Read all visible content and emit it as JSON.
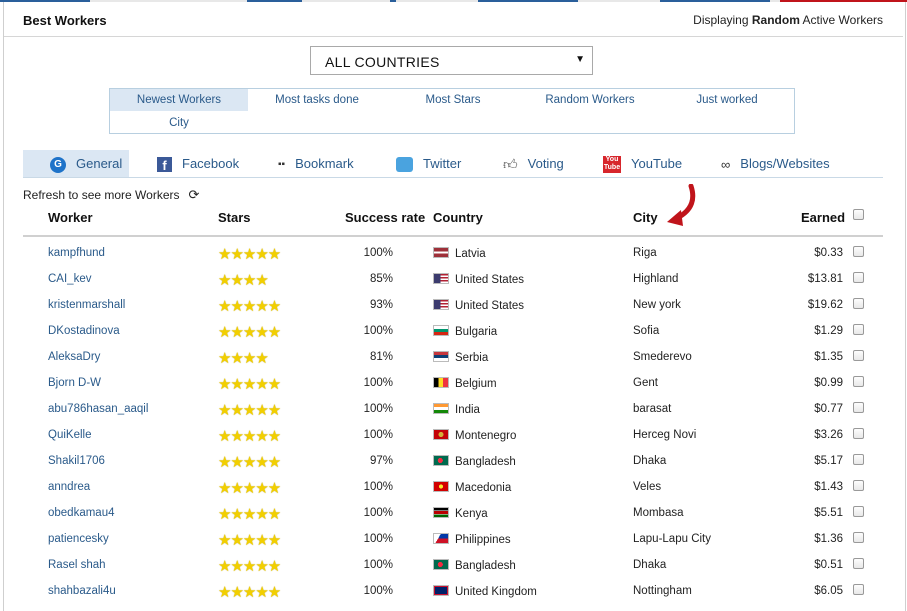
{
  "header": {
    "title": "Best Workers",
    "display_prefix": "Displaying ",
    "display_mode": "Random",
    "display_suffix": " Active Workers"
  },
  "country_select": {
    "value": "ALL COUNTRIES"
  },
  "filters": [
    {
      "label": "Newest Workers",
      "active": true
    },
    {
      "label": "Most tasks done",
      "active": false
    },
    {
      "label": "Most Stars",
      "active": false
    },
    {
      "label": "Random Workers",
      "active": false
    },
    {
      "label": "Just worked",
      "active": false
    },
    {
      "label": "City",
      "active": false
    }
  ],
  "tabs": [
    {
      "label": "General",
      "icon": "general-icon",
      "active": true
    },
    {
      "label": "Facebook",
      "icon": "facebook-icon"
    },
    {
      "label": "Bookmark",
      "icon": "bookmark-icon"
    },
    {
      "label": "Twitter",
      "icon": "twitter-icon"
    },
    {
      "label": "Voting",
      "icon": "thumbs-up-icon"
    },
    {
      "label": "YouTube",
      "icon": "youtube-icon"
    },
    {
      "label": "Blogs/Websites",
      "icon": "link-icon"
    }
  ],
  "refresh_label": "Refresh to see more Workers",
  "table": {
    "headers": {
      "worker": "Worker",
      "stars": "Stars",
      "success_rate": "Success rate",
      "country": "Country",
      "city": "City",
      "earned": "Earned"
    },
    "rows": [
      {
        "worker": "kampfhund",
        "stars": 5,
        "rate": "100%",
        "country": "Latvia",
        "city": "Riga",
        "earned": "$0.33"
      },
      {
        "worker": "CAI_kev",
        "stars": 4,
        "rate": "85%",
        "country": "United States",
        "city": "Highland",
        "earned": "$13.81"
      },
      {
        "worker": "kristenmarshall",
        "stars": 5,
        "rate": "93%",
        "country": "United States",
        "city": "New york",
        "earned": "$19.62"
      },
      {
        "worker": "DKostadinova",
        "stars": 5,
        "rate": "100%",
        "country": "Bulgaria",
        "city": "Sofia",
        "earned": "$1.29"
      },
      {
        "worker": "AleksaDry",
        "stars": 4,
        "rate": "81%",
        "country": "Serbia",
        "city": "Smederevo",
        "earned": "$1.35"
      },
      {
        "worker": "Bjorn D-W",
        "stars": 5,
        "rate": "100%",
        "country": "Belgium",
        "city": "Gent",
        "earned": "$0.99"
      },
      {
        "worker": "abu786hasan_aaqil",
        "stars": 5,
        "rate": "100%",
        "country": "India",
        "city": "barasat",
        "earned": "$0.77"
      },
      {
        "worker": "QuiKelle",
        "stars": 5,
        "rate": "100%",
        "country": "Montenegro",
        "city": "Herceg Novi",
        "earned": "$3.26"
      },
      {
        "worker": "Shakil1706",
        "stars": 5,
        "rate": "97%",
        "country": "Bangladesh",
        "city": "Dhaka",
        "earned": "$5.17"
      },
      {
        "worker": "anndrea",
        "stars": 5,
        "rate": "100%",
        "country": "Macedonia",
        "city": "Veles",
        "earned": "$1.43"
      },
      {
        "worker": "obedkamau4",
        "stars": 5,
        "rate": "100%",
        "country": "Kenya",
        "city": "Mombasa",
        "earned": "$5.51"
      },
      {
        "worker": "patiencesky",
        "stars": 5,
        "rate": "100%",
        "country": "Philippines",
        "city": "Lapu-Lapu City",
        "earned": "$1.36"
      },
      {
        "worker": "Rasel shah",
        "stars": 5,
        "rate": "100%",
        "country": "Bangladesh",
        "city": "Dhaka",
        "earned": "$0.51"
      },
      {
        "worker": "shahbazali4u",
        "stars": 5,
        "rate": "100%",
        "country": "United Kingdom",
        "city": "Nottingham",
        "earned": "$6.05"
      }
    ]
  },
  "colors": {
    "link": "#2a5a8a",
    "active_tab": "#dbe7f3",
    "star": "#f2cf00",
    "arrow": "#c0141b"
  }
}
